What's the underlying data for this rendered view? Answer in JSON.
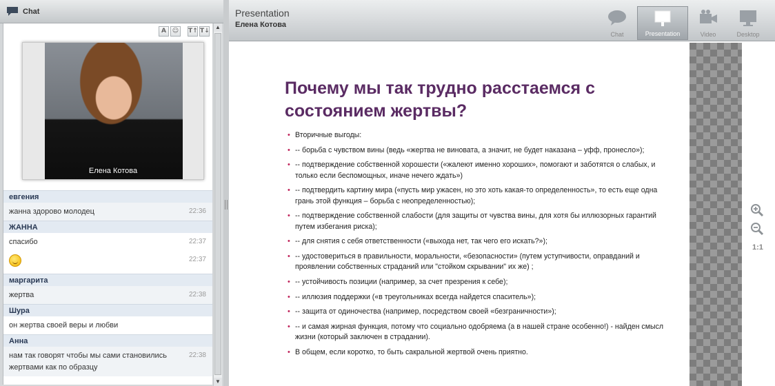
{
  "chat": {
    "title": "Chat",
    "tools": [
      "A",
      "☺",
      "T↑",
      "T↓"
    ],
    "video_name": "Елена Котова",
    "messages": [
      {
        "author": "евгения",
        "rows": [
          {
            "text": "жанна здорово молодец",
            "time": "22:36"
          }
        ]
      },
      {
        "author": "ЖАННА",
        "rows": [
          {
            "text": "спасибо",
            "time": "22:37"
          },
          {
            "text": "",
            "emoji": "smiley",
            "time": "22:37"
          }
        ]
      },
      {
        "author": "маргарита",
        "rows": [
          {
            "text": "жертва",
            "time": "22:38"
          }
        ]
      },
      {
        "author": "Шура",
        "rows": [
          {
            "text": "он жертва своей веры и любви",
            "time": ""
          }
        ]
      },
      {
        "author": "Анна",
        "rows": [
          {
            "text": "нам так говорят чтобы мы сами становились жертвами как по образцу",
            "time": "22:38"
          }
        ]
      }
    ]
  },
  "presentation": {
    "title": "Presentation",
    "presenter": "Елена Котова",
    "tabs": [
      {
        "label": "Chat",
        "icon": "chat-bubble-icon",
        "active": false
      },
      {
        "label": "Presentation",
        "icon": "presentation-board-icon",
        "active": true
      },
      {
        "label": "Video",
        "icon": "video-camera-icon",
        "active": false
      },
      {
        "label": "Desktop",
        "icon": "desktop-monitor-icon",
        "active": false
      }
    ],
    "zoom_level": "1:1",
    "slide": {
      "title": "Почему мы так трудно расстаемся с состоянием жертвы?",
      "bullets": [
        "Вторичные выгоды:",
        "-- борьба с чувством вины (ведь «жертва не виновата, а значит, не будет наказана – уфф, пронесло»);",
        "-- подтверждение собственной хорошести («жалеют именно хороших», помогают и заботятся о слабых, и только если беспомощных, иначе нечего ждать»)",
        "-- подтвердить картину мира («пусть мир ужасен, но это хоть какая-то определенность», то есть еще одна грань этой функция – борьба с неопределенностью);",
        "-- подтверждение собственной слабости (для защиты от чувства вины, для хотя бы иллюзорных гарантий путем избегания риска);",
        "-- для снятия с себя ответственности («выхода нет, так чего его искать?»);",
        "-- удостовериться в правильности, моральности, «безопасности» (путем уступчивости, оправданий и проявлении собственных страданий или \"стойком скрывании\" их же) ;",
        "-- устойчивость позиции (например, за счет презрения к себе);",
        "-- иллюзия поддержки («в треугольниках всегда найдется спаситель»);",
        "-- защита от одиночества (например, посредством своей «безграничности»);",
        "-- и самая жирная функция, потому что социально одобряема (а в нашей стране особенно!) - найден смысл жизни (который заключен в страдании).",
        "В общем, если коротко, то быть сакральной жертвой очень приятно."
      ]
    }
  },
  "colors": {
    "slide_title": "#5a2b63",
    "bullet": "#c0255b",
    "author_bg": "#e3eaf2"
  }
}
